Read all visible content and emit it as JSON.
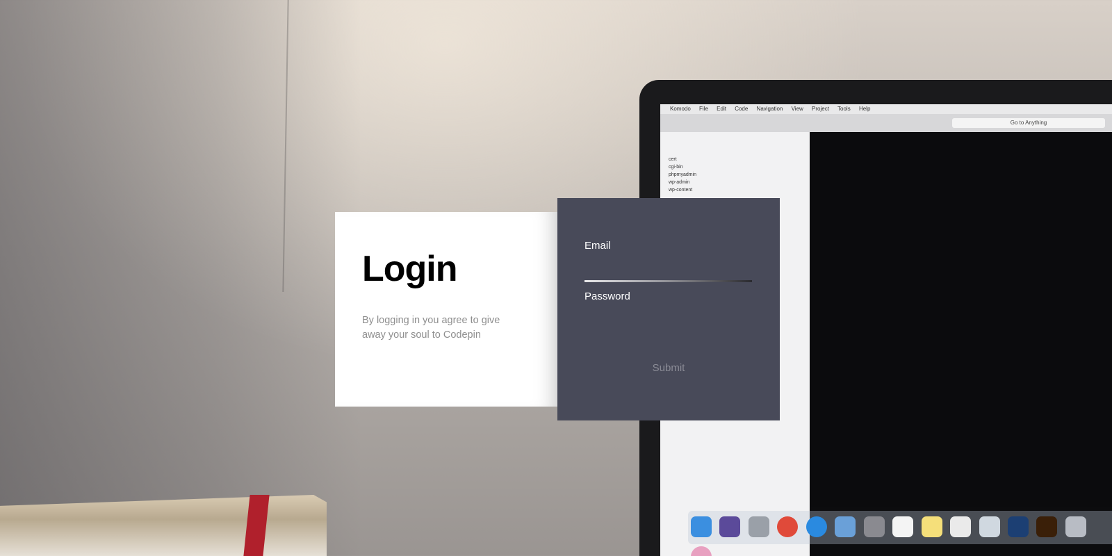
{
  "login": {
    "title": "Login",
    "subtitle": "By logging in you agree to give away your soul to Codepin"
  },
  "form": {
    "email_label": "Email",
    "email_value": "",
    "password_label": "Password",
    "password_value": "",
    "submit_label": "Submit"
  },
  "background": {
    "editor_menu": [
      "Komodo",
      "File",
      "Edit",
      "Code",
      "Navigation",
      "View",
      "Project",
      "Tools",
      "Help"
    ],
    "goto_label": "Go to Anything",
    "tree_items": [
      "cert",
      "cgi-bin",
      "phpmyadmin",
      "wp-admin",
      "wp-content"
    ]
  },
  "colors": {
    "form_panel": "#484a59",
    "card": "#ffffff",
    "subtitle": "#8e8e8e",
    "submit_text": "#8b8c96"
  }
}
